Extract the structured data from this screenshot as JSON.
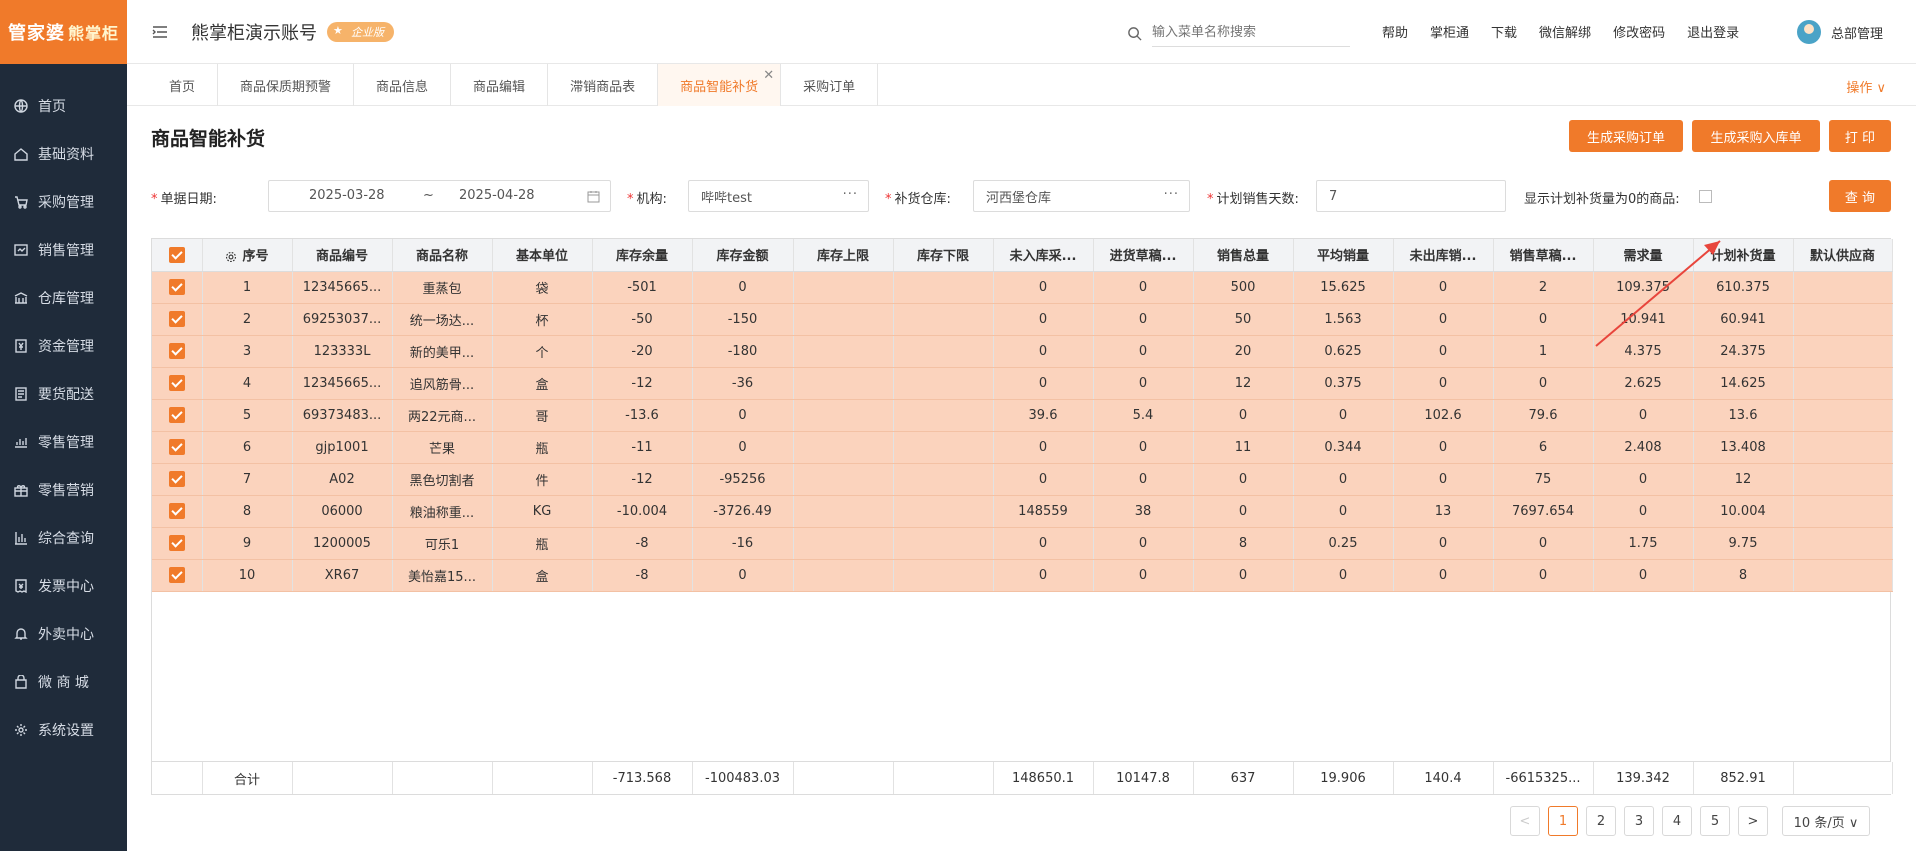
{
  "brand": {
    "name1": "管家婆",
    "name2": "熊掌柜"
  },
  "sidebar": {
    "items": [
      {
        "label": "首页",
        "icon": "globe-icon"
      },
      {
        "label": "基础资料",
        "icon": "home-icon"
      },
      {
        "label": "采购管理",
        "icon": "cart-icon"
      },
      {
        "label": "销售管理",
        "icon": "sales-icon"
      },
      {
        "label": "仓库管理",
        "icon": "warehouse-icon"
      },
      {
        "label": "资金管理",
        "icon": "money-icon"
      },
      {
        "label": "要货配送",
        "icon": "list-icon"
      },
      {
        "label": "零售管理",
        "icon": "chart-icon"
      },
      {
        "label": "零售营销",
        "icon": "gift-icon"
      },
      {
        "label": "综合查询",
        "icon": "bar-icon"
      },
      {
        "label": "发票中心",
        "icon": "invoice-icon"
      },
      {
        "label": "外卖中心",
        "icon": "bell-icon"
      },
      {
        "label": "微 商 城",
        "icon": "shop-icon"
      },
      {
        "label": "系统设置",
        "icon": "gear-icon"
      }
    ]
  },
  "header": {
    "account": "熊掌柜演示账号",
    "badge": "企业版",
    "search_placeholder": "输入菜单名称搜索",
    "links": [
      "帮助",
      "掌柜通",
      "下载",
      "微信解绑",
      "修改密码",
      "退出登录"
    ],
    "user": "总部管理"
  },
  "tabs": [
    "首页",
    "商品保质期预警",
    "商品信息",
    "商品编辑",
    "滞销商品表",
    "商品智能补货",
    "采购订单"
  ],
  "tabs_active": "商品智能补货",
  "tab_ops": "操作 ∨",
  "page": {
    "title": "商品智能补货",
    "buttons": {
      "gen_po": "生成采购订单",
      "gen_in": "生成采购入库单",
      "print": "打 印",
      "query": "查 询"
    }
  },
  "filters": {
    "date_label": "单据日期:",
    "date_from": "2025-03-28",
    "date_sep": "~",
    "date_to": "2025-04-28",
    "org_label": "机构:",
    "org_value": "哔哔test",
    "wh_label": "补货仓库:",
    "wh_value": "河西堡仓库",
    "days_label": "计划销售天数:",
    "days_value": "7",
    "show_zero_label": "显示计划补货量为0的商品:"
  },
  "table": {
    "headers": [
      "序号",
      "商品编号",
      "商品名称",
      "基本单位",
      "库存余量",
      "库存金额",
      "库存上限",
      "库存下限",
      "未入库采...",
      "进货草稿...",
      "销售总量",
      "平均销量",
      "未出库销...",
      "销售草稿...",
      "需求量",
      "计划补货量",
      "默认供应商"
    ],
    "rows": [
      [
        "1",
        "12345665...",
        "重蒸包",
        "袋",
        "-501",
        "0",
        "",
        "",
        "0",
        "0",
        "500",
        "15.625",
        "0",
        "2",
        "109.375",
        "610.375",
        ""
      ],
      [
        "2",
        "69253037...",
        "统一场达...",
        "杯",
        "-50",
        "-150",
        "",
        "",
        "0",
        "0",
        "50",
        "1.563",
        "0",
        "0",
        "10.941",
        "60.941",
        ""
      ],
      [
        "3",
        "123333L",
        "新的美甲...",
        "个",
        "-20",
        "-180",
        "",
        "",
        "0",
        "0",
        "20",
        "0.625",
        "0",
        "1",
        "4.375",
        "24.375",
        ""
      ],
      [
        "4",
        "12345665...",
        "追风筋骨...",
        "盒",
        "-12",
        "-36",
        "",
        "",
        "0",
        "0",
        "12",
        "0.375",
        "0",
        "0",
        "2.625",
        "14.625",
        ""
      ],
      [
        "5",
        "69373483...",
        "两22元商...",
        "哥",
        "-13.6",
        "0",
        "",
        "",
        "39.6",
        "5.4",
        "0",
        "0",
        "102.6",
        "79.6",
        "0",
        "13.6",
        ""
      ],
      [
        "6",
        "gjp1001",
        "芒果",
        "瓶",
        "-11",
        "0",
        "",
        "",
        "0",
        "0",
        "11",
        "0.344",
        "0",
        "6",
        "2.408",
        "13.408",
        ""
      ],
      [
        "7",
        "A02",
        "黑色切割者",
        "件",
        "-12",
        "-95256",
        "",
        "",
        "0",
        "0",
        "0",
        "0",
        "0",
        "75",
        "0",
        "12",
        ""
      ],
      [
        "8",
        "06000",
        "粮油称重...",
        "KG",
        "-10.004",
        "-3726.49",
        "",
        "",
        "148559",
        "38",
        "0",
        "0",
        "13",
        "7697.654",
        "0",
        "10.004",
        ""
      ],
      [
        "9",
        "1200005",
        "可乐1",
        "瓶",
        "-8",
        "-16",
        "",
        "",
        "0",
        "0",
        "8",
        "0.25",
        "0",
        "0",
        "1.75",
        "9.75",
        ""
      ],
      [
        "10",
        "XR67",
        "美怡嘉15...",
        "盒",
        "-8",
        "0",
        "",
        "",
        "0",
        "0",
        "0",
        "0",
        "0",
        "0",
        "0",
        "8",
        ""
      ]
    ],
    "totals": [
      "",
      "合计",
      "",
      "",
      "",
      "-713.568",
      "-100483.03",
      "",
      "",
      "148650.1",
      "10147.8",
      "637",
      "19.906",
      "140.4",
      "-6615325...",
      "139.342",
      "852.91",
      ""
    ]
  },
  "pagination": {
    "pages": [
      "1",
      "2",
      "3",
      "4",
      "5"
    ],
    "current": "1",
    "prev": "<",
    "next": ">",
    "page_size": "10 条/页 ∨"
  },
  "colors": {
    "accent": "#f07a2a",
    "sidebar": "#1f2b3a",
    "row_selected": "#fbd3bd"
  }
}
